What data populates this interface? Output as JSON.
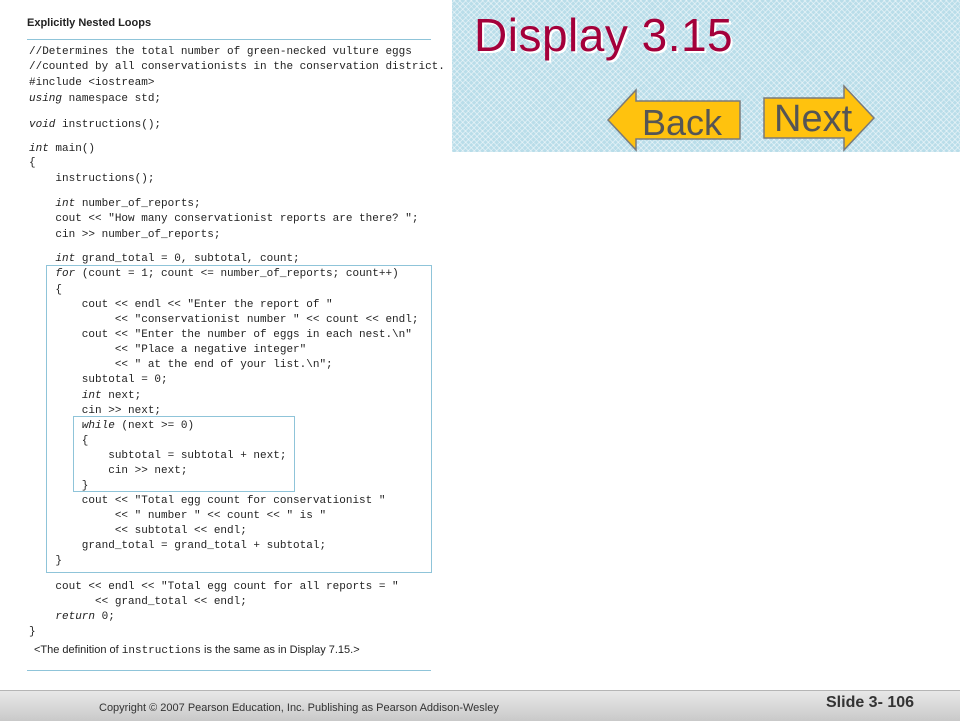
{
  "slide": {
    "title": "Display 3.15",
    "back_label": "Back",
    "next_label": "Next",
    "copyright": "Copyright © 2007 Pearson Education, Inc. Publishing as Pearson Addison-Wesley",
    "slide_number": "Slide 3- 106"
  },
  "listing": {
    "title": "Explicitly Nested Loops",
    "lines": [
      "//Determines the total number of green-necked vulture eggs",
      "//counted by all conservationists in the conservation district.",
      "#include <iostream>",
      "using namespace std;",
      "",
      "void instructions();",
      "",
      "int main()",
      "{",
      "    instructions();",
      "",
      "    int number_of_reports;",
      "    cout << \"How many conservationist reports are there? \";",
      "    cin >> number_of_reports;",
      "",
      "    int grand_total = 0, subtotal, count;",
      "    for (count = 1; count <= number_of_reports; count++)",
      "    {",
      "        cout << endl << \"Enter the report of \"",
      "             << \"conservationist number \" << count << endl;",
      "        cout << \"Enter the number of eggs in each nest.\\n\"",
      "             << \"Place a negative integer\"",
      "             << \" at the end of your list.\\n\";",
      "        subtotal = 0;",
      "        int next;",
      "        cin >> next;",
      "        while (next >= 0)",
      "        {",
      "            subtotal = subtotal + next;",
      "            cin >> next;",
      "        }",
      "        cout << \"Total egg count for conservationist \"",
      "             << \" number \" << count << \" is \"",
      "             << subtotal << endl;",
      "        grand_total = grand_total + subtotal;",
      "    }",
      "    cout << endl << \"Total egg count for all reports = \"",
      "          << grand_total << endl;",
      "    return 0;",
      "}"
    ],
    "footnote_pre": "<The definition of ",
    "footnote_code": "instructions",
    "footnote_post": " is the same as in Display 7.15.>"
  },
  "colors": {
    "title": "#a4003a",
    "arrow_fill": "#ffc20e",
    "panel": "#b9dde9",
    "box_border": "#8fc4d9"
  }
}
